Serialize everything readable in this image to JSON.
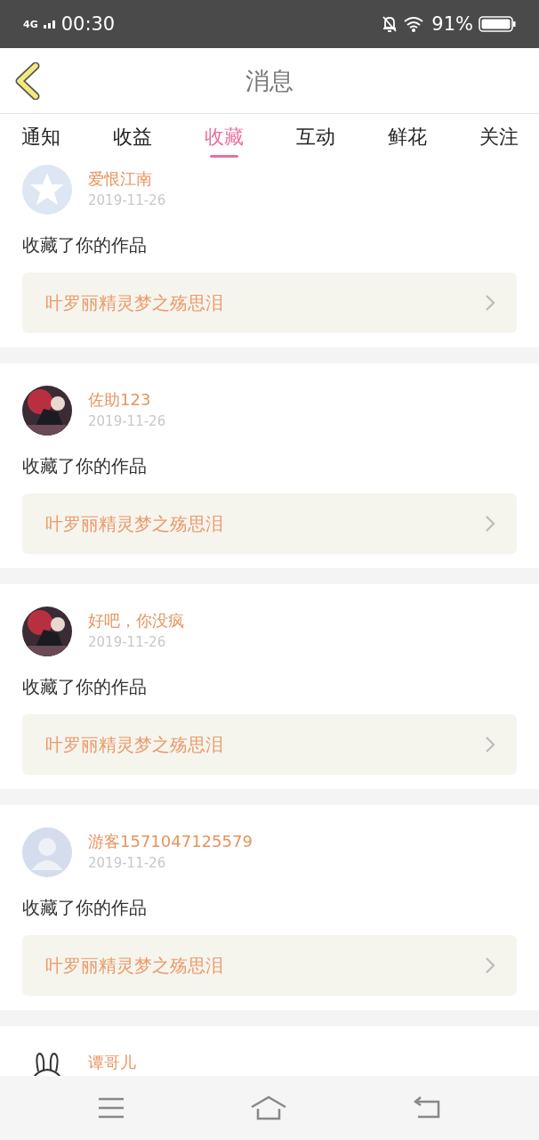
{
  "status_bar": {
    "network": "4G",
    "time": "00:30",
    "battery": "91%"
  },
  "header": {
    "title": "消息"
  },
  "tabs": [
    {
      "label": "通知",
      "selected": false
    },
    {
      "label": "收益",
      "selected": false
    },
    {
      "label": "收藏",
      "selected": true
    },
    {
      "label": "互动",
      "selected": false
    },
    {
      "label": "鲜花",
      "selected": false
    },
    {
      "label": "关注",
      "selected": false
    }
  ],
  "messages": [
    {
      "avatar": {
        "kind": "star"
      },
      "name": "爱恨江南",
      "date": "2019-11-26",
      "action": "收藏了你的作品",
      "work": "叶罗丽精灵梦之殇思泪"
    },
    {
      "name": "佐助123",
      "date": "2019-11-26",
      "action": "收藏了你的作品",
      "work": "叶罗丽精灵梦之殇思泪"
    },
    {
      "name": "好吧，你没疯",
      "date": "2019-11-26",
      "action": "收藏了你的作品",
      "work": "叶罗丽精灵梦之殇思泪"
    },
    {
      "avatar": {
        "kind": "silhouette"
      },
      "name": "游客1571047125579",
      "date": "2019-11-26",
      "action": "收藏了你的作品",
      "work": "叶罗丽精灵梦之殇思泪"
    },
    {
      "avatar": {
        "kind": "rabbit"
      },
      "name": "谭哥儿"
    }
  ]
}
